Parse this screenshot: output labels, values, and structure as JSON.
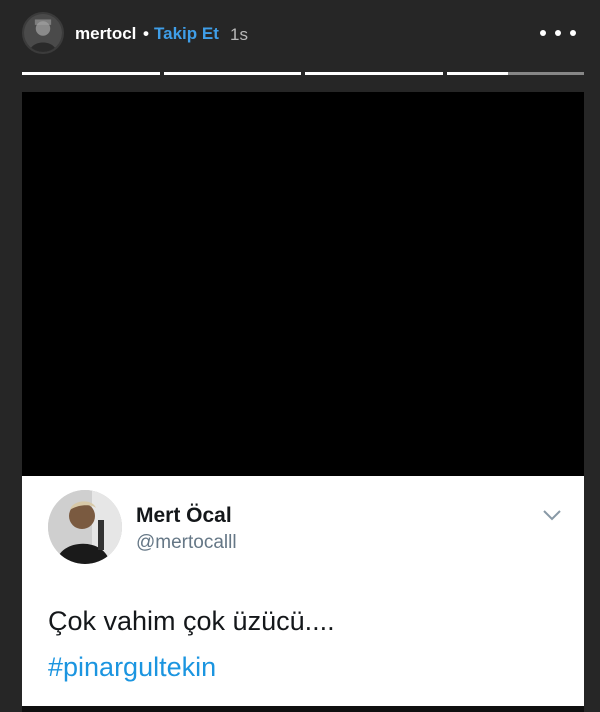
{
  "header": {
    "username": "mertocl",
    "separator": "•",
    "follow_label": "Takip Et",
    "time": "1s",
    "more_icon": "more-horizontal-icon"
  },
  "story_progress": {
    "segments": [
      {
        "fill": 1.0
      },
      {
        "fill": 1.0
      },
      {
        "fill": 1.0
      },
      {
        "fill": 0.45
      }
    ]
  },
  "tweet": {
    "name": "Mert Öcal",
    "handle": "@mertocalll",
    "text": "Çok vahim çok üzücü....",
    "hashtag": "#pinargultekin",
    "colors": {
      "hashtag": "#1b95e0",
      "handle": "#657786",
      "text": "#14171a"
    }
  },
  "colors": {
    "background": "#262626",
    "follow": "#3f9ee8",
    "media": "#000000"
  }
}
